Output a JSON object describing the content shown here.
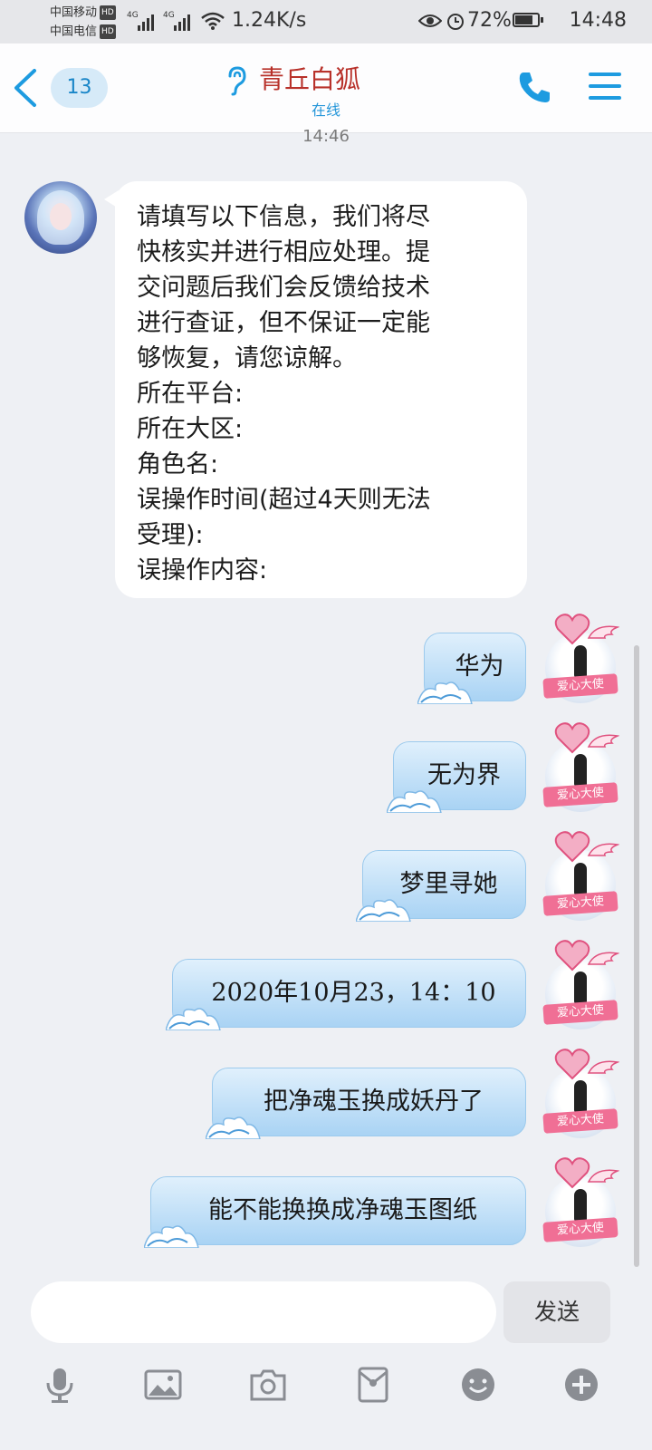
{
  "status_bar": {
    "carrier_1": "中国移动",
    "carrier_2": "中国电信",
    "hd_label": "HD",
    "network_label": "4G",
    "speed": "1.24K/s",
    "battery": "72%",
    "battery_level": 0.72,
    "time": "14:48"
  },
  "header": {
    "badge_count": "13",
    "title": "青丘白狐",
    "status": "在线",
    "title_color": "#b8312a",
    "accent_color": "#1d9be0"
  },
  "timestamp": "14:46",
  "incoming": {
    "text": "请填写以下信息，我们将尽\n快核实并进行相应处理。提\n交问题后我们会反馈给技术\n进行查证，但不保证一定能\n够恢复，请您谅解。\n所在平台:\n所在大区:\n角色名:\n误操作时间(超过4天则无法\n受理):\n误操作内容:"
  },
  "outgoing": [
    {
      "text": "华为"
    },
    {
      "text": "无为界"
    },
    {
      "text": "梦里寻她"
    },
    {
      "text": "2020年10月23，14：10"
    },
    {
      "text": "把净魂玉换成妖丹了"
    },
    {
      "text": "能不能换换成净魂玉图纸"
    }
  ],
  "avatar_badge": "爱心大使",
  "input": {
    "placeholder": "",
    "send_label": "发送"
  },
  "icons": [
    "microphone-icon",
    "image-icon",
    "camera-icon",
    "red-packet-icon",
    "emoji-icon",
    "plus-icon"
  ]
}
